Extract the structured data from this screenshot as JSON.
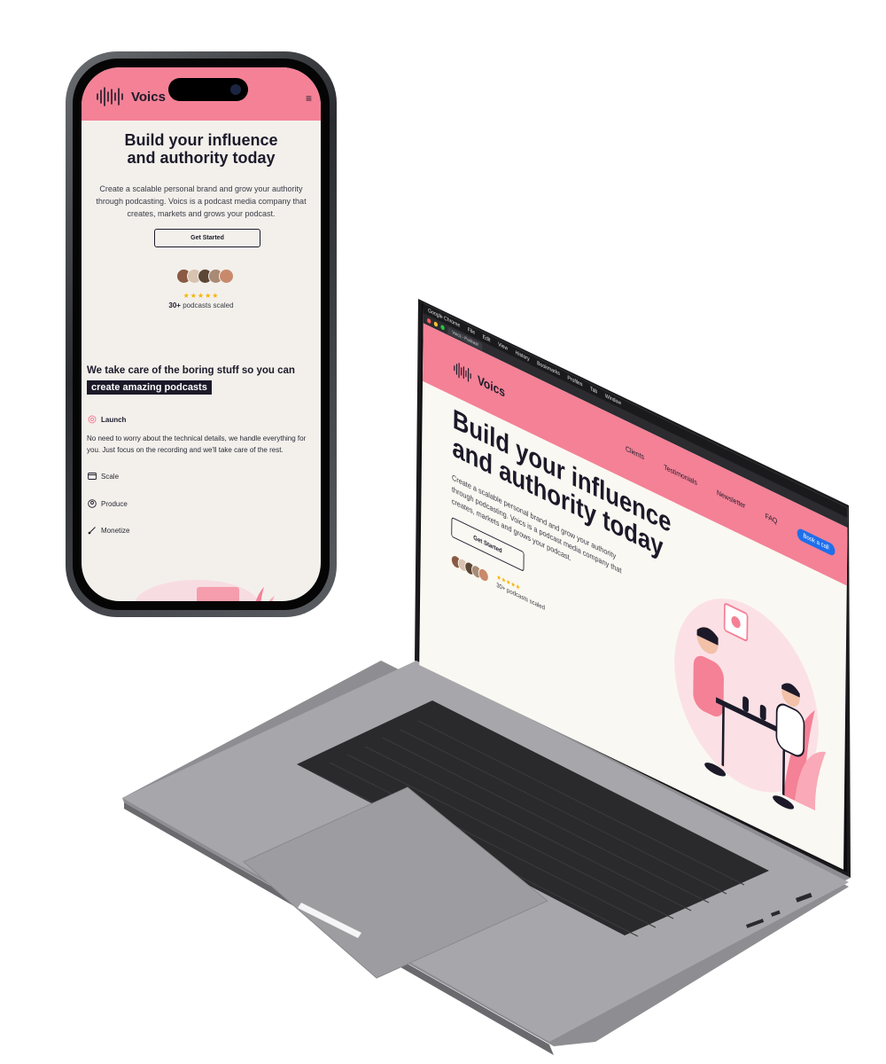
{
  "brand": {
    "name": "Voics",
    "primary": "#f48196",
    "dark": "#1c1a29",
    "background": "#f3f0ec",
    "star": "#f4b400"
  },
  "mobile": {
    "menu_icon": "≡",
    "hero": {
      "title": "Build your influence and authority today",
      "description": "Create a scalable personal brand and grow your authority through podcasting. Voics is a podcast media company that creates, markets and grows your podcast.",
      "cta": "Get Started",
      "stars": "★★★★★",
      "count": "30+",
      "count_suffix": " podcasts scaled"
    },
    "care": {
      "title": "We take care of the boring stuff so you can",
      "highlight": "create amazing podcasts",
      "features": [
        {
          "label": "Launch",
          "icon": "target-icon",
          "active": true
        },
        {
          "label": "Scale",
          "icon": "window-icon"
        },
        {
          "label": "Produce",
          "icon": "user-circle-icon"
        },
        {
          "label": "Monetize",
          "icon": "brush-icon"
        }
      ],
      "launch_desc": "No need to worry about the technical details, we handle everything for you. Just focus on the recording and we'll take care of the rest."
    }
  },
  "desktop": {
    "mac_menu": [
      "Google Chrome",
      "File",
      "Edit",
      "View",
      "History",
      "Bookmarks",
      "Profiles",
      "Tab",
      "Window"
    ],
    "tab_title": "Voics - Podcast",
    "nav": [
      "Clients",
      "Testimonials",
      "Newsletter",
      "FAQ"
    ],
    "nav_cta": "Book a call",
    "hero": {
      "title_line1": "Build your influence",
      "title_line2": "and authority today",
      "description": "Create a scalable personal brand and grow your authority through podcasting. Voics is a podcast media company that creates, markets and grows your podcast.",
      "cta": "Get Started",
      "stars": "★★★★★",
      "scaled": "30+ podcasts scaled"
    }
  }
}
